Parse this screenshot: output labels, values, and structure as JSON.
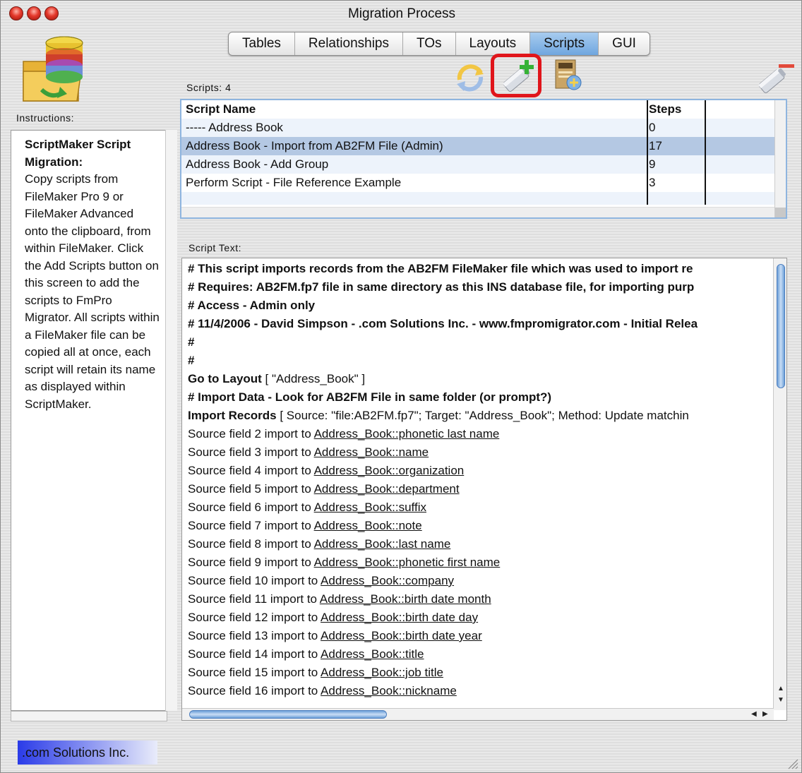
{
  "window": {
    "title": "Migration Process"
  },
  "tabs": [
    {
      "label": "Tables",
      "active": false
    },
    {
      "label": "Relationships",
      "active": false
    },
    {
      "label": "TOs",
      "active": false
    },
    {
      "label": "Layouts",
      "active": false
    },
    {
      "label": "Scripts",
      "active": true
    },
    {
      "label": "GUI",
      "active": false
    }
  ],
  "toolbar": {
    "refresh_icon": "refresh-arrows-icon",
    "add_icon": "add-script-icon",
    "open_icon": "open-script-file-icon",
    "remove_icon": "remove-script-icon"
  },
  "scripts": {
    "count_label": "Scripts: 4",
    "headers": {
      "name": "Script Name",
      "steps": "Steps"
    },
    "rows": [
      {
        "name": "----- Address Book",
        "steps": "0",
        "selected": false
      },
      {
        "name": "Address Book - Import from AB2FM File (Admin)",
        "steps": "17",
        "selected": true
      },
      {
        "name": "Address Book - Add Group",
        "steps": "9",
        "selected": false
      },
      {
        "name": "Perform Script - File Reference Example",
        "steps": "3",
        "selected": false
      }
    ]
  },
  "instructions": {
    "label": "Instructions:",
    "heading": "ScriptMaker Script Migration:",
    "body": "Copy scripts from FileMaker Pro 9 or FileMaker Advanced onto the clipboard, from within FileMaker. Click the Add Scripts button on this screen to add the scripts to FmPro Migrator. All scripts within a FileMaker file can be copied all at once, each script will retain its name as displayed within ScriptMaker."
  },
  "script_text": {
    "label": "Script Text:",
    "comments": [
      "#  This script imports records from the AB2FM FileMaker file which was used to import re",
      "#  Requires: AB2FM.fp7 file in same directory as this INS database file, for importing purp",
      "#  Access - Admin only",
      "#  11/4/2006 - David Simpson - .com Solutions Inc. - www.fmpromigrator.com - Initial Relea",
      "#",
      "#"
    ],
    "goto": {
      "step": "Go to Layout",
      "params": " [ \"Address_Book\" ]"
    },
    "import_comment": "#  Import Data - Look for AB2FM File in same folder (or prompt?)",
    "import": {
      "step": "Import Records",
      "params": "  [ Source: \"file:AB2FM.fp7\"; Target: \"Address_Book\"; Method: Update matchin"
    },
    "mappings": [
      {
        "prefix": "Source field 2 import to ",
        "field": "Address_Book::phonetic last name"
      },
      {
        "prefix": "Source field 3 import to ",
        "field": "Address_Book::name"
      },
      {
        "prefix": "Source field 4 import to ",
        "field": "Address_Book::organization"
      },
      {
        "prefix": "Source field 5 import to ",
        "field": "Address_Book::department"
      },
      {
        "prefix": "Source field 6 import to ",
        "field": "Address_Book::suffix"
      },
      {
        "prefix": "Source field 7 import to ",
        "field": "Address_Book::note"
      },
      {
        "prefix": "Source field 8 import to ",
        "field": "Address_Book::last name"
      },
      {
        "prefix": "Source field 9 import to ",
        "field": "Address_Book::phonetic first name"
      },
      {
        "prefix": "Source field 10 import to ",
        "field": "Address_Book::company"
      },
      {
        "prefix": "Source field 11 import to ",
        "field": "Address_Book::birth date month"
      },
      {
        "prefix": "Source field 12 import to ",
        "field": "Address_Book::birth date day"
      },
      {
        "prefix": "Source field 13 import to ",
        "field": "Address_Book::birth date year"
      },
      {
        "prefix": "Source field 14 import to ",
        "field": "Address_Book::title"
      },
      {
        "prefix": "Source field 15 import to ",
        "field": "Address_Book::job title"
      },
      {
        "prefix": "Source field 16 import to ",
        "field": "Address_Book::nickname"
      }
    ]
  },
  "footer": {
    "company": ".com Solutions Inc."
  },
  "colors": {
    "tab_active": "#7fb0e2",
    "row_selected": "#b4c8e3",
    "row_alt": "#edf3fb",
    "highlight": "#e0151b"
  }
}
